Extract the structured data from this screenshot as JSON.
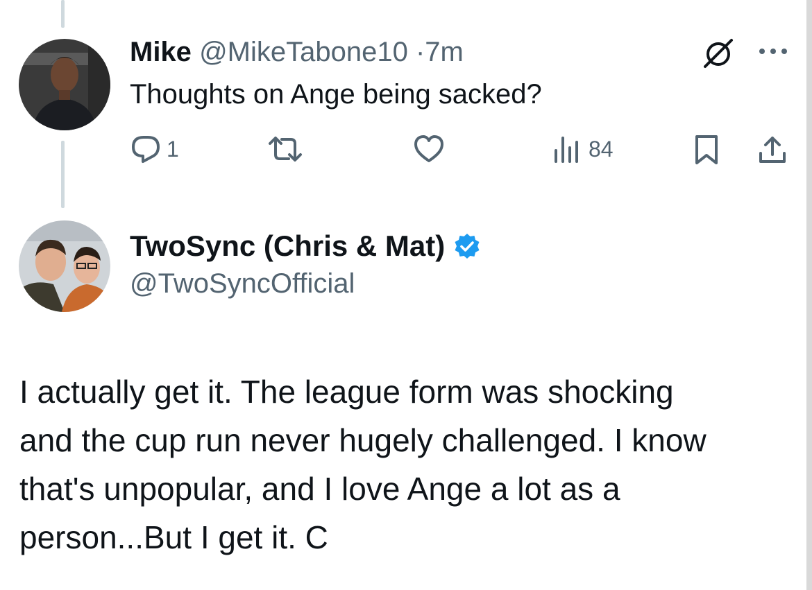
{
  "parent_tweet": {
    "author_name": "Mike",
    "handle": "@MikeTabone10",
    "separator": "·",
    "time": "7m",
    "text": "Thoughts on Ange being sacked?",
    "avatar_icon": "person-avatar",
    "actions": {
      "reply_count": "1",
      "retweet_count": "",
      "like_count": "",
      "views_count": "84"
    }
  },
  "reply_tweet": {
    "author_name": "TwoSync (Chris & Mat)",
    "handle": "@TwoSyncOfficial",
    "verified": true,
    "avatar_icon": "two-person-avatar",
    "text_lines": [
      "I actually get it. The league form was shocking",
      "and the cup run never hugely challenged. I know",
      "that's unpopular, and I love Ange a lot as a",
      "person...But I get it. C"
    ]
  },
  "colors": {
    "text_primary": "#0f1419",
    "text_secondary": "#536471",
    "verified_blue": "#1d9bf0",
    "thread_line": "#cfd9de"
  }
}
